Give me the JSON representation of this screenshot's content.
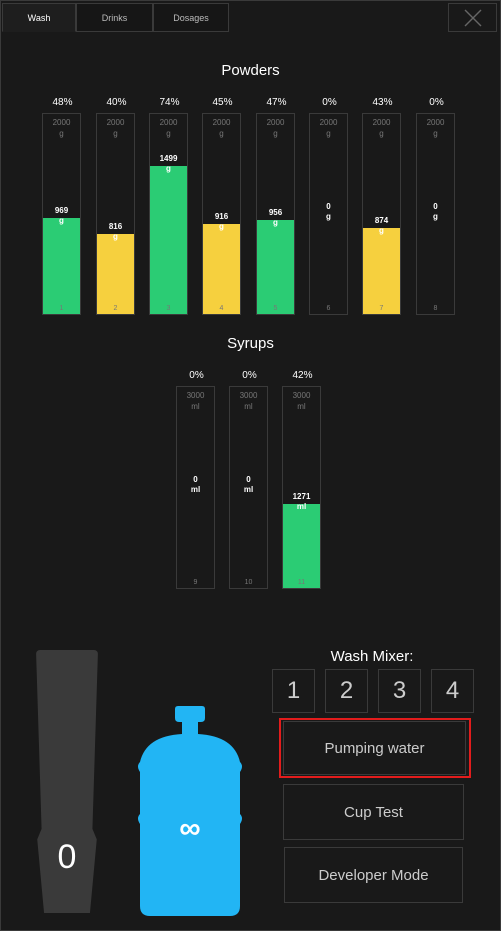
{
  "tabs": [
    {
      "label": "Wash",
      "active": true
    },
    {
      "label": "Drinks",
      "active": false
    },
    {
      "label": "Dosages",
      "active": false
    }
  ],
  "powders": {
    "title": "Powders",
    "tanks": [
      {
        "num": "1",
        "pct": "48%",
        "cap": "2000",
        "unit": "g",
        "current": "969",
        "level": 0.48,
        "color": "#2bcc74"
      },
      {
        "num": "2",
        "pct": "40%",
        "cap": "2000",
        "unit": "g",
        "current": "816",
        "level": 0.4,
        "color": "#f6d03e"
      },
      {
        "num": "3",
        "pct": "74%",
        "cap": "2000",
        "unit": "g",
        "current": "1499",
        "level": 0.74,
        "color": "#2bcc74"
      },
      {
        "num": "4",
        "pct": "45%",
        "cap": "2000",
        "unit": "g",
        "current": "916",
        "level": 0.45,
        "color": "#f6d03e"
      },
      {
        "num": "5",
        "pct": "47%",
        "cap": "2000",
        "unit": "g",
        "current": "956",
        "level": 0.47,
        "color": "#2bcc74"
      },
      {
        "num": "6",
        "pct": "0%",
        "cap": "2000",
        "unit": "g",
        "current": "0",
        "level": 0,
        "color": "#2bcc74"
      },
      {
        "num": "7",
        "pct": "43%",
        "cap": "2000",
        "unit": "g",
        "current": "874",
        "level": 0.43,
        "color": "#f6d03e"
      },
      {
        "num": "8",
        "pct": "0%",
        "cap": "2000",
        "unit": "g",
        "current": "0",
        "level": 0,
        "color": "#2bcc74"
      }
    ]
  },
  "syrups": {
    "title": "Syrups",
    "tanks": [
      {
        "num": "9",
        "pct": "0%",
        "cap": "3000",
        "unit": "ml",
        "current": "0",
        "level": 0,
        "color": "#2bcc74"
      },
      {
        "num": "10",
        "pct": "0%",
        "cap": "3000",
        "unit": "ml",
        "current": "0",
        "level": 0,
        "color": "#2bcc74"
      },
      {
        "num": "11",
        "pct": "42%",
        "cap": "3000",
        "unit": "ml",
        "current": "1271",
        "level": 0.42,
        "color": "#2bcc74"
      }
    ]
  },
  "cups": {
    "count": "0"
  },
  "water": {
    "label": "∞",
    "color": "#22b5f4"
  },
  "wash_mixer": {
    "title": "Wash Mixer:",
    "buttons": [
      "1",
      "2",
      "3",
      "4"
    ]
  },
  "actions": {
    "pumping": "Pumping water",
    "cup_test": "Cup Test",
    "developer": "Developer Mode"
  }
}
